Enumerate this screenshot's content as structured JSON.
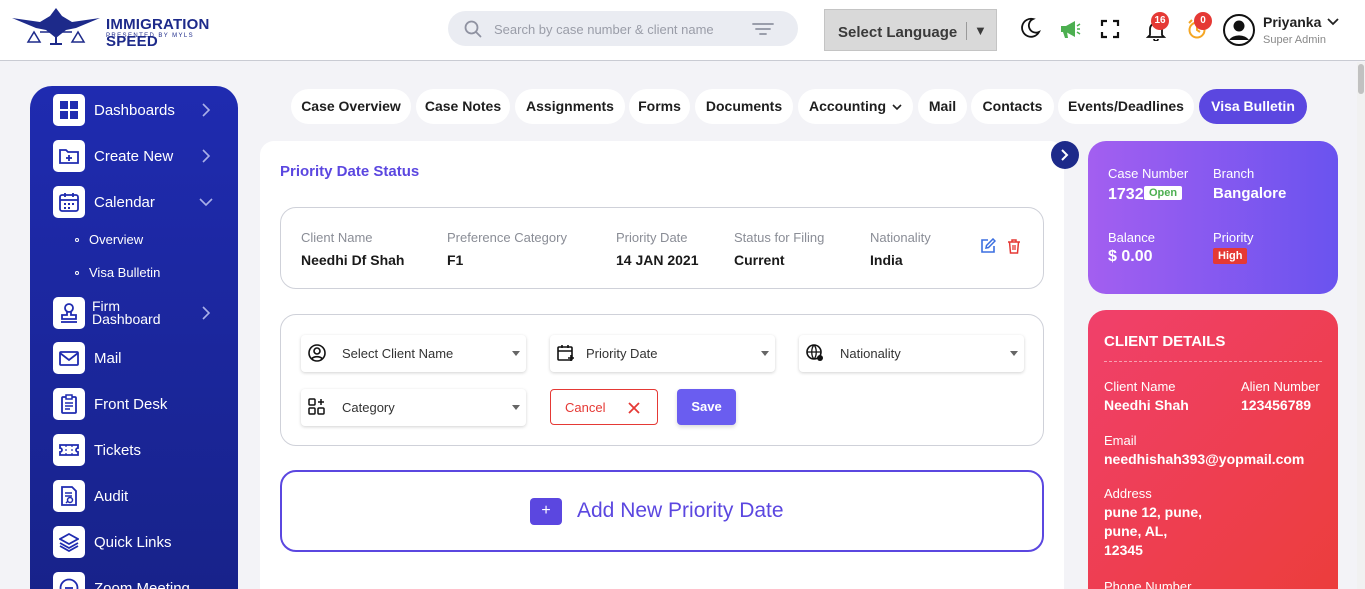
{
  "brand": {
    "title": "IMMIGRATION SPEED",
    "subtitle": "PRESENTED BY MYLS",
    "color": "#1d2a8a"
  },
  "search": {
    "placeholder": "Search by case number & client name"
  },
  "language": {
    "label": "Select Language",
    "arrow": "▼"
  },
  "notifications": {
    "bell_count": "16",
    "alarm_count": "0"
  },
  "user": {
    "name": "Priyanka",
    "role": "Super Admin"
  },
  "sidebar": {
    "items": [
      {
        "label": "Dashboards"
      },
      {
        "label": "Create New"
      },
      {
        "label": "Calendar"
      },
      {
        "label": "Overview"
      },
      {
        "label": "Visa Bulletin"
      },
      {
        "label_line1": "Firm",
        "label_line2": "Dashboard"
      },
      {
        "label": "Mail"
      },
      {
        "label": "Front Desk"
      },
      {
        "label": "Tickets"
      },
      {
        "label": "Audit"
      },
      {
        "label": "Quick Links"
      },
      {
        "label": "Zoom Meeting"
      }
    ]
  },
  "tabs": [
    {
      "label": "Case Overview"
    },
    {
      "label": "Case Notes"
    },
    {
      "label": "Assignments"
    },
    {
      "label": "Forms"
    },
    {
      "label": "Documents"
    },
    {
      "label": "Accounting"
    },
    {
      "label": "Mail"
    },
    {
      "label": "Contacts"
    },
    {
      "label": "Events/Deadlines"
    },
    {
      "label": "Visa Bulletin"
    }
  ],
  "priority": {
    "title": "Priority Date Status",
    "record": {
      "client_name_label": "Client Name",
      "client_name": "Needhi Df Shah",
      "pref_label": "Preference Category",
      "pref": "F1",
      "pdate_label": "Priority Date",
      "pdate": "14 JAN 2021",
      "status_label": "Status for Filing",
      "status": "Current",
      "nat_label": "Nationality",
      "nat": "India"
    },
    "form": {
      "client_select": "Select Client Name",
      "date_select": "Priority Date",
      "nat_select": "Nationality",
      "cat_select": "Category",
      "cancel": "Cancel",
      "save": "Save"
    },
    "add_button": "Add New Priority Date",
    "add_plus": "+"
  },
  "case": {
    "number_label": "Case Number",
    "number": "1732",
    "status": "Open",
    "branch_label": "Branch",
    "branch": "Bangalore",
    "balance_label": "Balance",
    "balance": "$ 0.00",
    "priority_label": "Priority",
    "priority": "High"
  },
  "client": {
    "title": "CLIENT DETAILS",
    "name_label": "Client Name",
    "name": "Needhi Shah",
    "alien_label": "Alien Number",
    "alien": "123456789",
    "email_label": "Email",
    "email": "needhishah393@yopmail.com",
    "address_label": "Address",
    "address_lines": [
      "pune 12, pune,",
      "pune, AL,",
      "12345"
    ],
    "phone_label": "Phone Number"
  },
  "colors": {
    "accent": "#5b47e0",
    "sidebar": "#1f2bb0",
    "danger": "#e53935",
    "success": "#4caf50"
  }
}
